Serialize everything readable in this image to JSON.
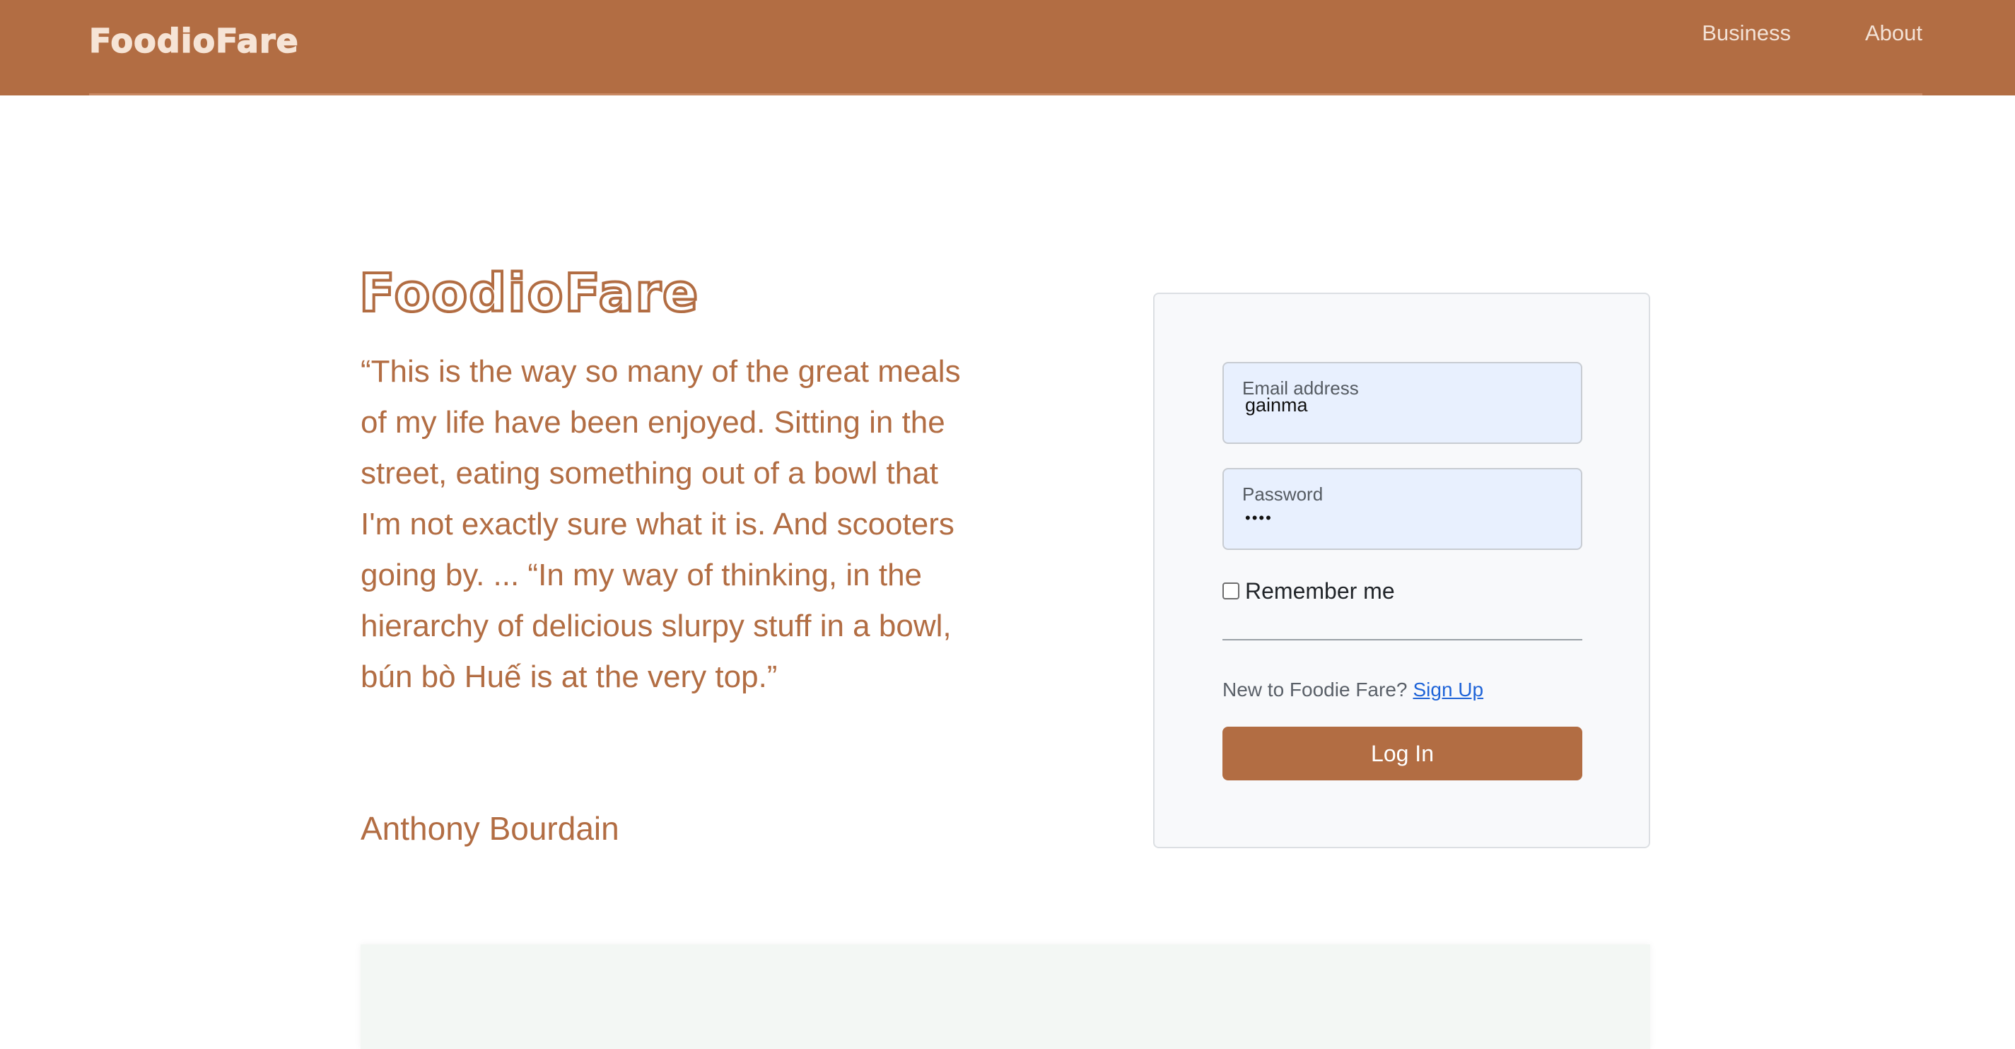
{
  "header": {
    "brand": "FoodioFare",
    "nav": {
      "business": "Business",
      "about": "About"
    }
  },
  "hero": {
    "title": "FoodioFare",
    "quote": "“This is the way so many of the great meals of my life have been enjoyed. Sitting in the street, eating something out of a bowl that I'm not exactly sure what it is. And scooters going by. ... “In my way of thinking, in the hierarchy of delicious slurpy stuff in a bowl, bún bò Huế is at the very top.”",
    "author": "Anthony Bourdain"
  },
  "login": {
    "email_label": "Email address",
    "email_value": "gainma",
    "password_label": "Password",
    "password_value": "••••",
    "remember_label": "Remember me",
    "signup_prompt": "New to Foodie Fare?",
    "signup_link": "Sign Up",
    "submit_label": "Log In"
  },
  "colors": {
    "brand": "#b26d43",
    "field_bg": "#e8f0fe",
    "link": "#1f64d8"
  }
}
